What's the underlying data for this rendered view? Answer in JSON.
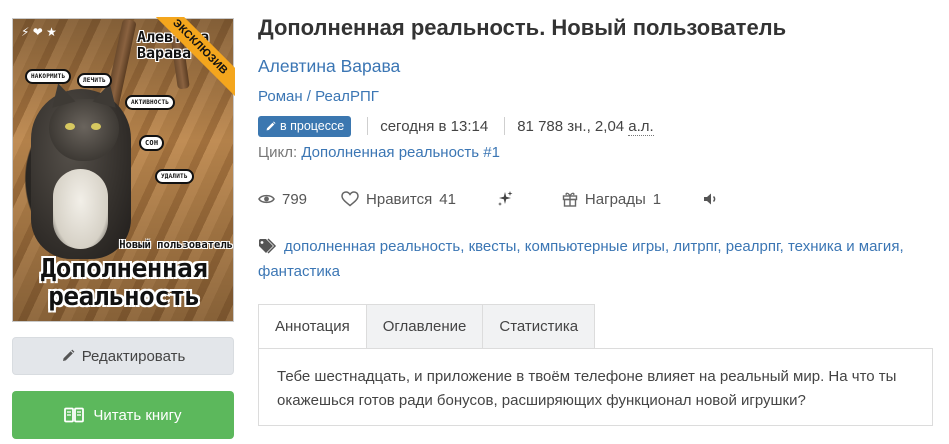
{
  "cover": {
    "exclusive_label": "ЭКСКЛЮЗИВ",
    "author_text": "Алевтина Варава",
    "subtitle_text": "Новый пользователь",
    "title_text": "Дополненная реальность",
    "top_icons": "⚡ ❤ ★",
    "bubbles": [
      "НАКОРМИТЬ",
      "ЛЕЧИТЬ",
      "АКТИВНОСТЬ",
      "СОН",
      "УДАЛИТЬ"
    ]
  },
  "actions": {
    "edit_label": "Редактировать",
    "read_label": "Читать книгу"
  },
  "book": {
    "title": "Дополненная реальность. Новый пользователь",
    "author": "Алевтина Варава",
    "genres": [
      "Роман",
      "РеалРПГ"
    ],
    "genre_separator": " / ",
    "status": "в процессе",
    "updated": "сегодня в 13:14",
    "volume_chars": "81 788 зн., 2,04",
    "volume_al": "а.л.",
    "cycle_label": "Цикл:",
    "cycle_name": "Дополненная реальность #1"
  },
  "stats": {
    "views": "799",
    "likes_label": "Нравится",
    "likes_count": "41",
    "awards_label": "Награды",
    "awards_count": "1"
  },
  "tags": {
    "items": [
      "дополненная реальность",
      "квесты",
      "компьютерные игры",
      "литрпг",
      "реалрпг",
      "техника и магия",
      "фантастика"
    ],
    "separator": ", "
  },
  "tabs": [
    {
      "label": "Аннотация",
      "active": true
    },
    {
      "label": "Оглавление",
      "active": false
    },
    {
      "label": "Статистика",
      "active": false
    }
  ],
  "annotation": "Тебе шестнадцать, и приложение в твоём телефоне влияет на реальный мир. На что ты окажешься готов ради бонусов, расширяющих функционал новой игрушки?",
  "colors": {
    "link": "#3b76b4",
    "status_badge": "#3b77b0",
    "read_button": "#5cb85c",
    "edit_button": "#e3e6ea",
    "exclusive_ribbon": "#f4a61d"
  },
  "icons": [
    "pencil-icon",
    "book-open-icon",
    "eye-icon",
    "heart-icon",
    "sparkles-icon",
    "gift-icon",
    "speaker-icon",
    "tag-icon"
  ]
}
